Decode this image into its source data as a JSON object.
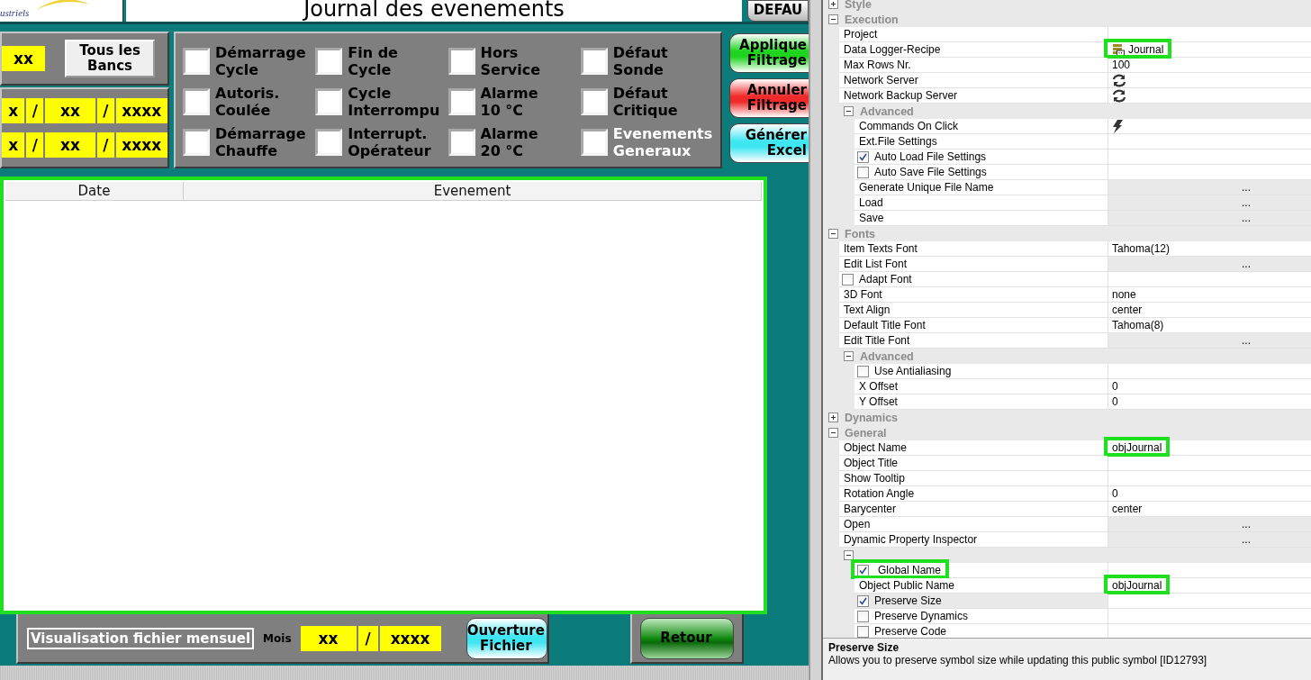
{
  "header": {
    "logo_text": "ustriels",
    "title": "Journal des evenements",
    "default_button": "DEFAU"
  },
  "bench": {
    "value": "xx",
    "all_button": "Tous les Bancs"
  },
  "date_rows": [
    [
      "x",
      "/",
      "xx",
      "/",
      "xxxx"
    ],
    [
      "x",
      "/",
      "xx",
      "/",
      "xxxx"
    ]
  ],
  "filters": [
    {
      "label": "Démarrage\nCycle",
      "checked": false,
      "color": "#000000"
    },
    {
      "label": "Fin de\nCycle",
      "checked": false,
      "color": "#000000"
    },
    {
      "label": "Hors\nService",
      "checked": false,
      "color": "#000000"
    },
    {
      "label": "Défaut\nSonde",
      "checked": false,
      "color": "#000000"
    },
    {
      "label": "Autoris.\nCoulée",
      "checked": false,
      "color": "#000000"
    },
    {
      "label": "Cycle\nInterrompu",
      "checked": false,
      "color": "#000000"
    },
    {
      "label": "Alarme\n10 °C",
      "checked": false,
      "color": "#000000"
    },
    {
      "label": "Défaut\nCritique",
      "checked": false,
      "color": "#000000"
    },
    {
      "label": "Démarrage\nChauffe",
      "checked": false,
      "color": "#000000"
    },
    {
      "label": "Interrupt.\nOpérateur",
      "checked": false,
      "color": "#000000"
    },
    {
      "label": "Alarme\n20 °C",
      "checked": false,
      "color": "#000000"
    },
    {
      "label": "Evenements\nGeneraux",
      "checked": false,
      "color": "#ffffff"
    }
  ],
  "side_buttons": [
    {
      "label": "Applique\nFiltrage",
      "color": "#1ed41e"
    },
    {
      "label": "Annuler\nFiltrage",
      "color": "#f02a2a"
    },
    {
      "label": "Générer\nExcel",
      "color": "#3ee6f2"
    }
  ],
  "table": {
    "columns": [
      "Date",
      "Evenement"
    ]
  },
  "bottom": {
    "file_label": "Visualisation fichier mensuel",
    "month_label": "Mois",
    "month": [
      "xx",
      "/",
      "xxxx"
    ],
    "open_button": "Ouverture\nFichier",
    "back_button": "Retour"
  },
  "grid": [
    {
      "kind": "category",
      "label": "Style",
      "expanded": false
    },
    {
      "kind": "category",
      "label": "Execution",
      "expanded": true,
      "children": [
        {
          "kind": "property",
          "label": "Project",
          "selected": false
        },
        {
          "kind": "data-logger",
          "label": "Data Logger-Recipe",
          "value": "Journal",
          "highlighted": true,
          "selected": false
        },
        {
          "kind": "property",
          "label": "Max Rows Nr.",
          "value": "100",
          "selected": false
        },
        {
          "kind": "server",
          "label": "Network Server",
          "selected": false
        },
        {
          "kind": "server",
          "label": "Network Backup Server",
          "selected": false
        },
        {
          "kind": "category",
          "label": "Advanced",
          "expanded": true,
          "children": [
            {
              "kind": "commands",
              "label": "Commands On Click",
              "selected": false
            },
            {
              "kind": "property",
              "label": "Ext.File Settings",
              "selected": false
            },
            {
              "kind": "checkbox",
              "label": "Auto Load File Settings",
              "checked": true,
              "selected": false
            },
            {
              "kind": "checkbox",
              "label": "Auto Save File Settings",
              "checked": false,
              "selected": false
            },
            {
              "kind": "button",
              "label": "Generate Unique File Name",
              "value": "...",
              "selected": false
            },
            {
              "kind": "button",
              "label": "Load",
              "value": "...",
              "selected": false
            },
            {
              "kind": "button",
              "label": "Save",
              "value": "...",
              "selected": false
            }
          ]
        }
      ]
    },
    {
      "kind": "category",
      "label": "Fonts",
      "expanded": true,
      "children": [
        {
          "kind": "property",
          "label": "Item Texts Font",
          "value": "Tahoma(12)",
          "selected": false
        },
        {
          "kind": "button",
          "label": "Edit List Font",
          "value": "...",
          "selected": false
        },
        {
          "kind": "checkbox",
          "label": "Adapt Font",
          "checked": false,
          "selected": false
        },
        {
          "kind": "property",
          "label": "3D Font",
          "value": "none",
          "selected": false
        },
        {
          "kind": "property",
          "label": "Text Align",
          "value": "center",
          "selected": false
        },
        {
          "kind": "property",
          "label": "Default Title Font",
          "value": "Tahoma(8)",
          "selected": false
        },
        {
          "kind": "button",
          "label": "Edit Title Font",
          "value": "...",
          "selected": false
        },
        {
          "kind": "category",
          "label": "Advanced",
          "expanded": true,
          "children": [
            {
              "kind": "checkbox",
              "label": "Use Antialiasing",
              "checked": false,
              "selected": false
            },
            {
              "kind": "property",
              "label": "X Offset",
              "value": "0",
              "selected": false
            },
            {
              "kind": "property",
              "label": "Y Offset",
              "value": "0",
              "selected": false
            }
          ]
        }
      ]
    },
    {
      "kind": "category",
      "label": "Dynamics",
      "expanded": false
    },
    {
      "kind": "category",
      "label": "General",
      "expanded": true,
      "children": [
        {
          "kind": "property",
          "label": "Object Name",
          "value": "objJournal",
          "highlighted": true,
          "selected": false
        },
        {
          "kind": "property",
          "label": "Object Title",
          "selected": false
        },
        {
          "kind": "property",
          "label": "Show Tooltip",
          "selected": false
        },
        {
          "kind": "property",
          "label": "Rotation Angle",
          "value": "0",
          "selected": false
        },
        {
          "kind": "property",
          "label": "Barycenter",
          "value": "center",
          "selected": false
        },
        {
          "kind": "button",
          "label": "Open",
          "value": "...",
          "selected": false
        },
        {
          "kind": "button",
          "label": "Dynamic Property Inspector",
          "value": "...",
          "selected": false
        },
        {
          "kind": "category",
          "expanded": true,
          "children": [
            {
              "kind": "checkbox",
              "label": "Global Name",
              "checked": true,
              "highlighted": true,
              "selected": false
            },
            {
              "kind": "property",
              "label": "Object Public Name",
              "value": "objJournal",
              "highlighted": true,
              "selected": false
            },
            {
              "kind": "checkbox",
              "label": "Preserve Size",
              "checked": true,
              "selected": true
            },
            {
              "kind": "checkbox",
              "label": "Preserve Dynamics",
              "checked": false,
              "selected": false
            },
            {
              "kind": "checkbox",
              "label": "Preserve Code",
              "checked": false,
              "selected": false
            }
          ]
        }
      ]
    }
  ],
  "description": {
    "title": "Preserve Size",
    "text": "Allows you to preserve symbol size while updating this public symbol [ID12793]"
  }
}
